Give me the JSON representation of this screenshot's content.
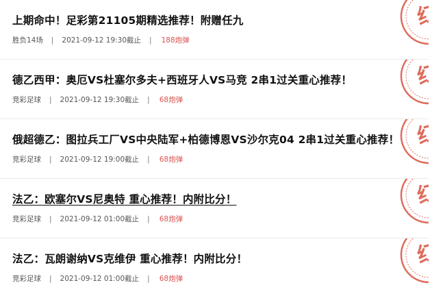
{
  "stamp": {
    "text": "红",
    "color": "#d9533f"
  },
  "articles": [
    {
      "title": "上期命中！足彩第21105期精选推荐！附赠任九",
      "category": "胜负14场",
      "time": "2021-09-12 19:30截止",
      "price": "188炮弹"
    },
    {
      "title": "德乙西甲：奥厄VS杜塞尔多夫+西班牙人VS马竞 2串1过关重心推荐！",
      "category": "竞彩足球",
      "time": "2021-09-12 19:30截止",
      "price": "68炮弹"
    },
    {
      "title": "俄超德乙：图拉兵工厂VS中央陆军+柏德博恩VS沙尔克04 2串1过关重心推荐！",
      "category": "竞彩足球",
      "time": "2021-09-12 19:00截止",
      "price": "68炮弹"
    },
    {
      "title": "法乙：欧塞尔VS尼奥特 重心推荐！内附比分！",
      "category": "竞彩足球",
      "time": "2021-09-12 01:00截止",
      "price": "68炮弹"
    },
    {
      "title": "法乙：瓦朗谢纳VS克维伊 重心推荐！内附比分！",
      "category": "竞彩足球",
      "time": "2021-09-12 01:00截止",
      "price": "68炮弹"
    }
  ]
}
